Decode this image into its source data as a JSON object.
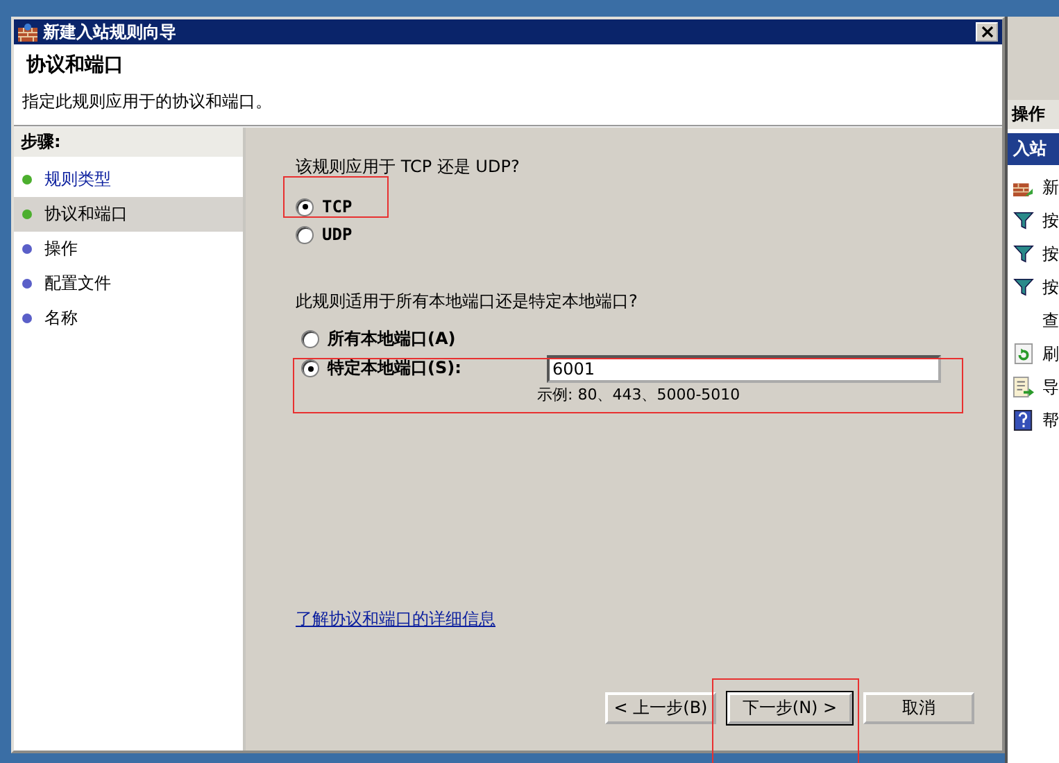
{
  "window": {
    "title": "新建入站规则向导"
  },
  "header": {
    "title": "协议和端口",
    "subtitle": "指定此规则应用于的协议和端口。"
  },
  "steps": {
    "heading": "步骤:",
    "items": [
      {
        "label": "规则类型",
        "selected": false,
        "link": true,
        "color": "#4caf2e"
      },
      {
        "label": "协议和端口",
        "selected": true,
        "link": false,
        "color": "#4caf2e"
      },
      {
        "label": "操作",
        "selected": false,
        "link": false,
        "color": "#5a5fc8"
      },
      {
        "label": "配置文件",
        "selected": false,
        "link": false,
        "color": "#5a5fc8"
      },
      {
        "label": "名称",
        "selected": false,
        "link": false,
        "color": "#5a5fc8"
      }
    ]
  },
  "protocol": {
    "question": "该规则应用于 TCP 还是 UDP?",
    "options": [
      {
        "label": "TCP",
        "selected": true
      },
      {
        "label": "UDP",
        "selected": false
      }
    ]
  },
  "ports": {
    "question": "此规则适用于所有本地端口还是特定本地端口?",
    "options": [
      {
        "label": "所有本地端口(A)",
        "selected": false
      },
      {
        "label": "特定本地端口(S):",
        "selected": true
      }
    ],
    "value": "6001",
    "example": "示例: 80、443、5000-5010"
  },
  "link": "了解协议和端口的详细信息",
  "buttons": [
    {
      "label": "< 上一步(B)",
      "default": false
    },
    {
      "label": "下一步(N) >",
      "default": true
    },
    {
      "label": "取消",
      "default": false
    }
  ],
  "background_panel": {
    "heading": "操作",
    "section": "入站",
    "items": [
      {
        "label": "新",
        "kind": "new"
      },
      {
        "label": "按",
        "kind": "filter"
      },
      {
        "label": "按",
        "kind": "filter"
      },
      {
        "label": "按",
        "kind": "filter"
      },
      {
        "label": "查",
        "kind": "none"
      },
      {
        "label": "刷",
        "kind": "refresh"
      },
      {
        "label": "导",
        "kind": "export"
      },
      {
        "label": "帮",
        "kind": "help"
      }
    ]
  }
}
